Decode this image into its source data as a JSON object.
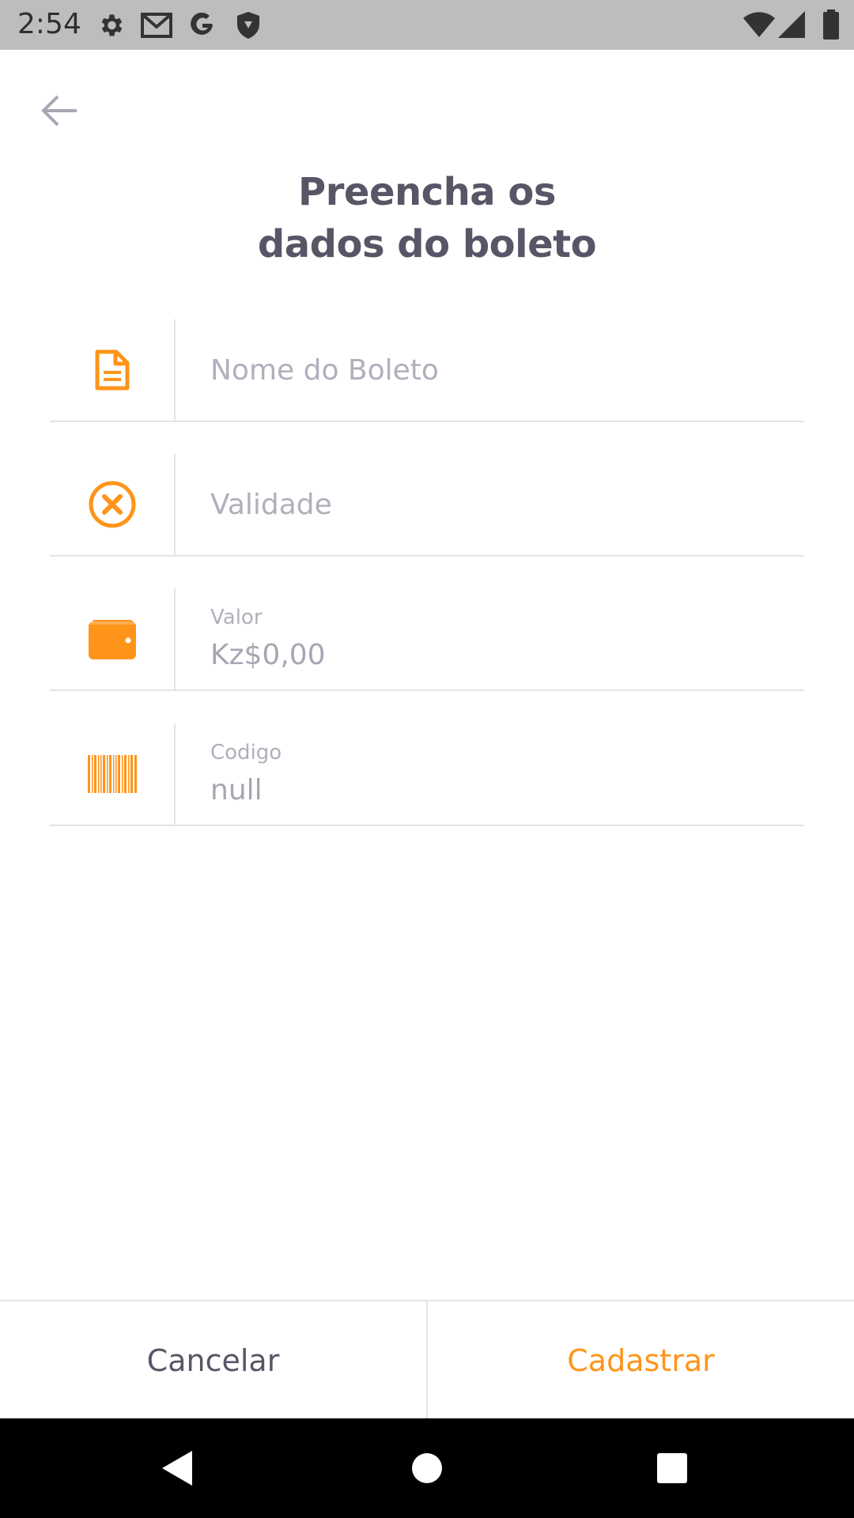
{
  "status_bar": {
    "time": "2:54",
    "left_icons": [
      "settings-icon",
      "gmail-icon",
      "google-icon",
      "shield-icon"
    ],
    "right_icons": [
      "wifi-icon",
      "signal-icon",
      "battery-icon"
    ]
  },
  "header": {
    "back_icon": "arrow-left-icon",
    "title_line1": "Preencha os",
    "title_line2": "dados do boleto"
  },
  "form": {
    "name": {
      "icon": "document-icon",
      "placeholder": "Nome do Boleto"
    },
    "validity": {
      "icon": "close-circle-icon",
      "placeholder": "Validade"
    },
    "amount": {
      "icon": "wallet-icon",
      "label": "Valor",
      "value": "Kz$0,00"
    },
    "code": {
      "icon": "barcode-icon",
      "label": "Codigo",
      "value": "null"
    }
  },
  "actions": {
    "cancel_label": "Cancelar",
    "submit_label": "Cadastrar"
  },
  "colors": {
    "accent": "#ff941a",
    "title": "#585666",
    "placeholder": "#b1afbb",
    "divider": "#e3e3e6"
  }
}
